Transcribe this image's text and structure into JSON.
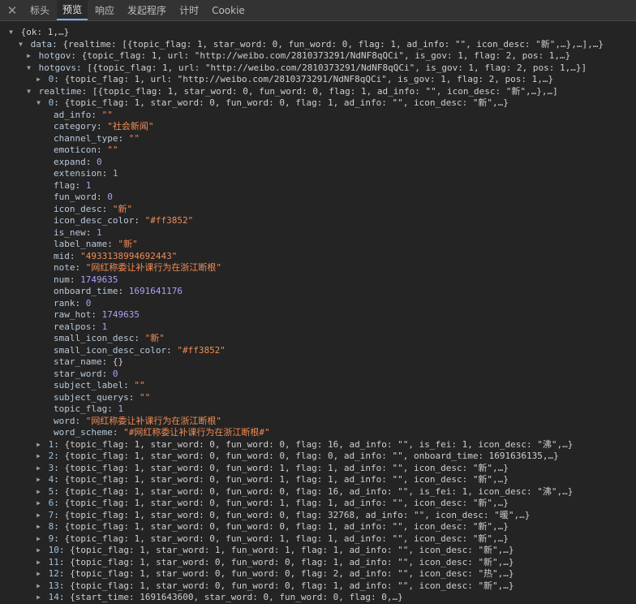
{
  "tabs": [
    "标头",
    "预览",
    "响应",
    "发起程序",
    "计时",
    "Cookie"
  ],
  "active_tab": 1,
  "lines": [
    {
      "indent": 8,
      "arrow": "down",
      "key": "",
      "text": "{ok: 1,…}"
    },
    {
      "indent": 20,
      "arrow": "down",
      "key": "data",
      "text": "{realtime: [{topic_flag: 1, star_word: 0, fun_word: 0, flag: 1, ad_info: \"\", icon_desc: \"新\",…},…],…}"
    },
    {
      "indent": 30,
      "arrow": "right",
      "key": "hotgov",
      "text": "{topic_flag: 1, url: \"http://weibo.com/2810373291/NdNF8qQCi\", is_gov: 1, flag: 2, pos: 1,…}"
    },
    {
      "indent": 30,
      "arrow": "down",
      "key": "hotgovs",
      "text": "[{topic_flag: 1, url: \"http://weibo.com/2810373291/NdNF8qQCi\", is_gov: 1, flag: 2, pos: 1,…}]"
    },
    {
      "indent": 42,
      "arrow": "right",
      "key": "0",
      "text": "{topic_flag: 1, url: \"http://weibo.com/2810373291/NdNF8qQCi\", is_gov: 1, flag: 2, pos: 1,…}"
    },
    {
      "indent": 30,
      "arrow": "down",
      "key": "realtime",
      "text": "[{topic_flag: 1, star_word: 0, fun_word: 0, flag: 1, ad_info: \"\", icon_desc: \"新\",…},…]"
    },
    {
      "indent": 42,
      "arrow": "down",
      "key": "0",
      "text": "{topic_flag: 1, star_word: 0, fun_word: 0, flag: 1, ad_info: \"\", icon_desc: \"新\",…}"
    },
    {
      "indent": 66,
      "arrow": "",
      "key": "ad_info",
      "val": "\"\"",
      "vtype": "str"
    },
    {
      "indent": 66,
      "arrow": "",
      "key": "category",
      "val": "\"社会新闻\"",
      "vtype": "str"
    },
    {
      "indent": 66,
      "arrow": "",
      "key": "channel_type",
      "val": "\"\"",
      "vtype": "str"
    },
    {
      "indent": 66,
      "arrow": "",
      "key": "emoticon",
      "val": "\"\"",
      "vtype": "str"
    },
    {
      "indent": 66,
      "arrow": "",
      "key": "expand",
      "val": "0",
      "vtype": "num"
    },
    {
      "indent": 66,
      "arrow": "",
      "key": "extension",
      "val": "1",
      "vtype": "num"
    },
    {
      "indent": 66,
      "arrow": "",
      "key": "flag",
      "val": "1",
      "vtype": "num"
    },
    {
      "indent": 66,
      "arrow": "",
      "key": "fun_word",
      "val": "0",
      "vtype": "num"
    },
    {
      "indent": 66,
      "arrow": "",
      "key": "icon_desc",
      "val": "\"新\"",
      "vtype": "str"
    },
    {
      "indent": 66,
      "arrow": "",
      "key": "icon_desc_color",
      "val": "\"#ff3852\"",
      "vtype": "str"
    },
    {
      "indent": 66,
      "arrow": "",
      "key": "is_new",
      "val": "1",
      "vtype": "num"
    },
    {
      "indent": 66,
      "arrow": "",
      "key": "label_name",
      "val": "\"新\"",
      "vtype": "str"
    },
    {
      "indent": 66,
      "arrow": "",
      "key": "mid",
      "val": "\"4933138994692443\"",
      "vtype": "str"
    },
    {
      "indent": 66,
      "arrow": "",
      "key": "note",
      "val": "\"网红称委让补课行为在浙江断根\"",
      "vtype": "str"
    },
    {
      "indent": 66,
      "arrow": "",
      "key": "num",
      "val": "1749635",
      "vtype": "num"
    },
    {
      "indent": 66,
      "arrow": "",
      "key": "onboard_time",
      "val": "1691641176",
      "vtype": "num"
    },
    {
      "indent": 66,
      "arrow": "",
      "key": "rank",
      "val": "0",
      "vtype": "num"
    },
    {
      "indent": 66,
      "arrow": "",
      "key": "raw_hot",
      "val": "1749635",
      "vtype": "num"
    },
    {
      "indent": 66,
      "arrow": "",
      "key": "realpos",
      "val": "1",
      "vtype": "num"
    },
    {
      "indent": 66,
      "arrow": "",
      "key": "small_icon_desc",
      "val": "\"新\"",
      "vtype": "str"
    },
    {
      "indent": 66,
      "arrow": "",
      "key": "small_icon_desc_color",
      "val": "\"#ff3852\"",
      "vtype": "str"
    },
    {
      "indent": 66,
      "arrow": "",
      "key": "star_name",
      "val": "{}",
      "vtype": "plain"
    },
    {
      "indent": 66,
      "arrow": "",
      "key": "star_word",
      "val": "0",
      "vtype": "num"
    },
    {
      "indent": 66,
      "arrow": "",
      "key": "subject_label",
      "val": "\"\"",
      "vtype": "str"
    },
    {
      "indent": 66,
      "arrow": "",
      "key": "subject_querys",
      "val": "\"\"",
      "vtype": "str"
    },
    {
      "indent": 66,
      "arrow": "",
      "key": "topic_flag",
      "val": "1",
      "vtype": "num"
    },
    {
      "indent": 66,
      "arrow": "",
      "key": "word",
      "val": "\"网红称委让补课行为在浙江断根\"",
      "vtype": "str"
    },
    {
      "indent": 66,
      "arrow": "",
      "key": "word_scheme",
      "val": "\"#网红称委让补课行为在浙江断根#\"",
      "vtype": "str"
    },
    {
      "indent": 42,
      "arrow": "right",
      "key": "1",
      "text": "{topic_flag: 1, star_word: 0, fun_word: 0, flag: 16, ad_info: \"\", is_fei: 1, icon_desc: \"沸\",…}"
    },
    {
      "indent": 42,
      "arrow": "right",
      "key": "2",
      "text": "{topic_flag: 1, star_word: 0, fun_word: 0, flag: 0, ad_info: \"\", onboard_time: 1691636135,…}"
    },
    {
      "indent": 42,
      "arrow": "right",
      "key": "3",
      "text": "{topic_flag: 1, star_word: 0, fun_word: 1, flag: 1, ad_info: \"\", icon_desc: \"新\",…}"
    },
    {
      "indent": 42,
      "arrow": "right",
      "key": "4",
      "text": "{topic_flag: 1, star_word: 0, fun_word: 1, flag: 1, ad_info: \"\", icon_desc: \"新\",…}"
    },
    {
      "indent": 42,
      "arrow": "right",
      "key": "5",
      "text": "{topic_flag: 1, star_word: 0, fun_word: 0, flag: 16, ad_info: \"\", is_fei: 1, icon_desc: \"沸\",…}"
    },
    {
      "indent": 42,
      "arrow": "right",
      "key": "6",
      "text": "{topic_flag: 1, star_word: 0, fun_word: 1, flag: 1, ad_info: \"\", icon_desc: \"新\",…}"
    },
    {
      "indent": 42,
      "arrow": "right",
      "key": "7",
      "text": "{topic_flag: 1, star_word: 0, fun_word: 0, flag: 32768, ad_info: \"\", icon_desc: \"暖\",…}"
    },
    {
      "indent": 42,
      "arrow": "right",
      "key": "8",
      "text": "{topic_flag: 1, star_word: 0, fun_word: 0, flag: 1, ad_info: \"\", icon_desc: \"新\",…}"
    },
    {
      "indent": 42,
      "arrow": "right",
      "key": "9",
      "text": "{topic_flag: 1, star_word: 0, fun_word: 1, flag: 1, ad_info: \"\", icon_desc: \"新\",…}"
    },
    {
      "indent": 42,
      "arrow": "right",
      "key": "10",
      "text": "{topic_flag: 1, star_word: 1, fun_word: 1, flag: 1, ad_info: \"\", icon_desc: \"新\",…}"
    },
    {
      "indent": 42,
      "arrow": "right",
      "key": "11",
      "text": "{topic_flag: 1, star_word: 0, fun_word: 0, flag: 1, ad_info: \"\", icon_desc: \"新\",…}"
    },
    {
      "indent": 42,
      "arrow": "right",
      "key": "12",
      "text": "{topic_flag: 1, star_word: 0, fun_word: 0, flag: 2, ad_info: \"\", icon_desc: \"热\",…}"
    },
    {
      "indent": 42,
      "arrow": "right",
      "key": "13",
      "text": "{topic_flag: 1, star_word: 0, fun_word: 0, flag: 1, ad_info: \"\", icon_desc: \"新\",…}"
    },
    {
      "indent": 42,
      "arrow": "right",
      "key": "14",
      "text": "{start_time: 1691643600, star_word: 0, fun_word: 0, flag: 0,…}"
    }
  ]
}
